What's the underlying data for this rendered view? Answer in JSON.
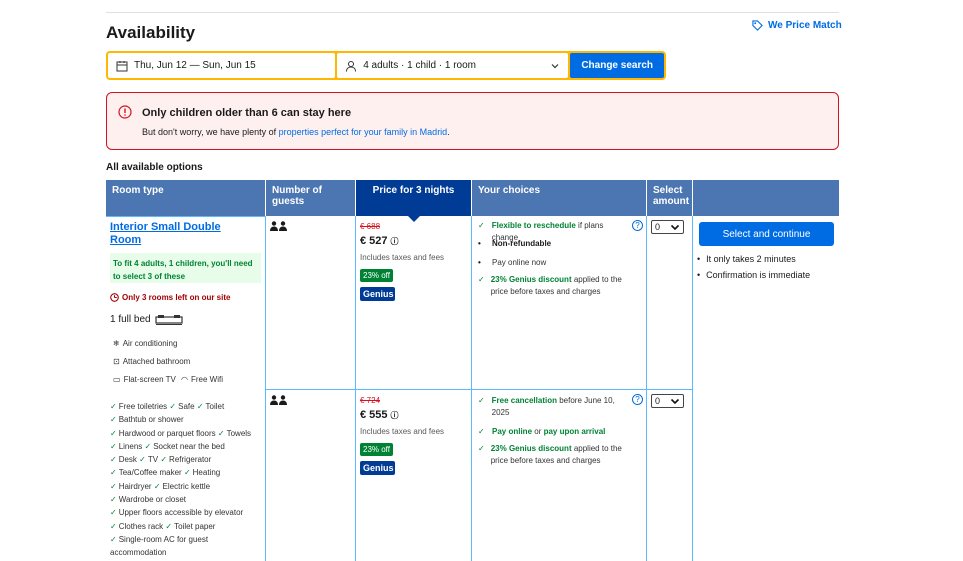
{
  "header": {
    "title": "Availability",
    "price_match": "We Price Match"
  },
  "search": {
    "dates": "Thu, Jun 12  —  Sun, Jun 15",
    "guests": "4 adults · 1 child · 1 room",
    "button": "Change search"
  },
  "alert": {
    "heading": "Only children older than 6 can stay here",
    "body_prefix": "But don't worry, we have plenty of ",
    "link": "properties perfect for your family in Madrid",
    "body_suffix": "."
  },
  "table": {
    "caption": "All available options",
    "headers": {
      "room_type": "Room type",
      "guests": "Number of guests",
      "price": "Price for 3 nights",
      "choices": "Your choices",
      "select": "Select amount"
    }
  },
  "room": {
    "name": "Interior Small Double Room",
    "fit_note": "To fit 4 adults, 1 children, you'll need to select 3 of these",
    "rooms_left": "Only 3 rooms left on our site",
    "bed": "1 full bed",
    "amenities": [
      "Air conditioning",
      "Attached bathroom",
      "Flat-screen TV",
      "Free Wifi"
    ],
    "facilities": [
      "Free toiletries",
      "Safe",
      "Toilet",
      "Bathtub or shower",
      "Hardwood or parquet floors",
      "Towels",
      "Linens",
      "Socket near the bed",
      "Desk",
      "TV",
      "Refrigerator",
      "Tea/Coffee maker",
      "Heating",
      "Hairdryer",
      "Electric kettle",
      "Wardrobe or closet",
      "Upper floors accessible by elevator",
      "Clothes rack",
      "Toilet paper",
      "Single-room AC for guest accommodation"
    ]
  },
  "options": [
    {
      "old_price": "€ 688",
      "price": "€ 527",
      "tax": "Includes taxes and fees",
      "discount": "23% off",
      "genius": "Genius",
      "choices": [
        {
          "bold": "Flexible to reschedule",
          "rest": " if plans change"
        },
        {
          "bold": "Non-refundable",
          "rest": ""
        },
        {
          "bold": "",
          "rest": "Pay online now"
        },
        {
          "bold": "23% Genius discount",
          "rest": " applied to the price before taxes and charges"
        }
      ],
      "select": "0"
    },
    {
      "old_price": "€ 724",
      "price": "€ 555",
      "tax": "Includes taxes and fees",
      "discount": "23% off",
      "genius": "Genius",
      "choices": [
        {
          "bold": "Free cancellation",
          "rest": " before June 10, 2025"
        },
        {
          "bold": "Pay online",
          "mid": " or ",
          "bold2": "pay upon arrival"
        },
        {
          "bold": "23% Genius discount",
          "rest": " applied to the price before taxes and charges"
        }
      ],
      "select": "0"
    }
  ],
  "cta": {
    "button": "Select and continue",
    "bullets": [
      "It only takes 2 minutes",
      "Confirmation is immediate"
    ]
  }
}
